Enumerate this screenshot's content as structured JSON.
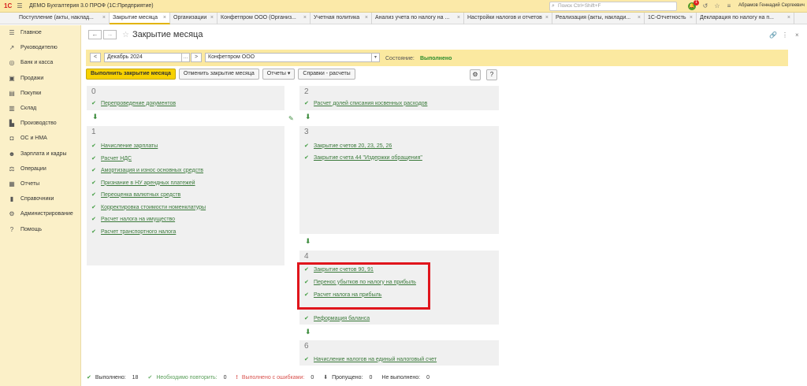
{
  "app": {
    "logo": "1С",
    "title": "ДЕМО Бухгалтерия 3.0 ПРОФ  (1С:Предприятие)",
    "search_placeholder": "Поиск Ctrl+Shift+F",
    "notification_count": "1",
    "user": "Абрамов Геннадий Сергеевич"
  },
  "tabs": [
    {
      "label": "Поступление (акты, наклад...",
      "active": false
    },
    {
      "label": "Закрытие месяца",
      "active": true
    },
    {
      "label": "Организации",
      "active": false
    },
    {
      "label": "Конфетпром ООО (Организ...",
      "active": false
    },
    {
      "label": "Учетная политика",
      "active": false
    },
    {
      "label": "Анализ учета по налогу на ...",
      "active": false
    },
    {
      "label": "Настройки налогов и отчетов",
      "active": false
    },
    {
      "label": "Реализация (акты, наклади...",
      "active": false
    },
    {
      "label": "1С-Отчетность",
      "active": false
    },
    {
      "label": "Декларация по налогу на п...",
      "active": false
    }
  ],
  "sidebar": {
    "items": [
      {
        "label": "Главное",
        "icon": "menu-icon"
      },
      {
        "label": "Руководителю",
        "icon": "trend-icon"
      },
      {
        "label": "Банк и касса",
        "icon": "coins-icon"
      },
      {
        "label": "Продажи",
        "icon": "cart-icon"
      },
      {
        "label": "Покупки",
        "icon": "basket-icon"
      },
      {
        "label": "Склад",
        "icon": "warehouse-icon"
      },
      {
        "label": "Производство",
        "icon": "factory-icon"
      },
      {
        "label": "ОС и НМА",
        "icon": "car-icon"
      },
      {
        "label": "Зарплата и кадры",
        "icon": "people-icon"
      },
      {
        "label": "Операции",
        "icon": "operations-icon"
      },
      {
        "label": "Отчеты",
        "icon": "report-icon"
      },
      {
        "label": "Справочники",
        "icon": "book-icon"
      },
      {
        "label": "Администрирование",
        "icon": "gear-icon"
      },
      {
        "label": "Помощь",
        "icon": "help-icon"
      }
    ]
  },
  "page": {
    "title": "Закрытие месяца",
    "period": "Декабрь 2024",
    "organization": "Конфетпром ООО",
    "state_label": "Состояние:",
    "state_value": "Выполнено"
  },
  "buttons": {
    "run": "Выполнить закрытие месяца",
    "cancel": "Отменить закрытие месяца",
    "reports": "Отчеты",
    "help_calc": "Справки - расчеты",
    "help": "?"
  },
  "stages": {
    "s0": {
      "num": "0",
      "items": [
        "Перепроведение документов"
      ]
    },
    "s1": {
      "num": "1",
      "items": [
        "Начисление зарплаты",
        "Расчет НДС",
        "Амортизация и износ основных средств",
        "Признание в НУ арендных платежей",
        "Переоценка валютных средств",
        "Корректировка стоимости номенклатуры",
        "Расчет налога на имущество",
        "Расчет транспортного налога"
      ]
    },
    "s2": {
      "num": "2",
      "items": [
        "Расчет долей списания косвенных расходов"
      ]
    },
    "s3": {
      "num": "3",
      "items": [
        "Закрытие счетов 20, 23, 25, 26",
        "Закрытие счета 44 \"Издержки обращения\""
      ]
    },
    "s4": {
      "num": "4",
      "items": [
        "Закрытие счетов 90, 91",
        "Перенос убытков по налогу на прибыль",
        "Расчет налога на прибыль",
        "Реформация баланса"
      ]
    },
    "s6": {
      "num": "6",
      "items": [
        "Начисление налогов на единый налоговый счет"
      ]
    }
  },
  "footer": {
    "done_label": "Выполнено:",
    "done_value": "18",
    "repeat_label": "Необходимо повторить:",
    "repeat_value": "0",
    "errors_label": "Выполнено с ошибками:",
    "errors_value": "0",
    "skipped_label": "Пропущено:",
    "skipped_value": "0",
    "notdone_label": "Не выполнено:",
    "notdone_value": "0"
  },
  "colors": {
    "accent": "#f7d100",
    "link": "#3b7a3b",
    "done": "#2c8c2c",
    "highlight": "#e0151c",
    "error": "#d9534f"
  }
}
